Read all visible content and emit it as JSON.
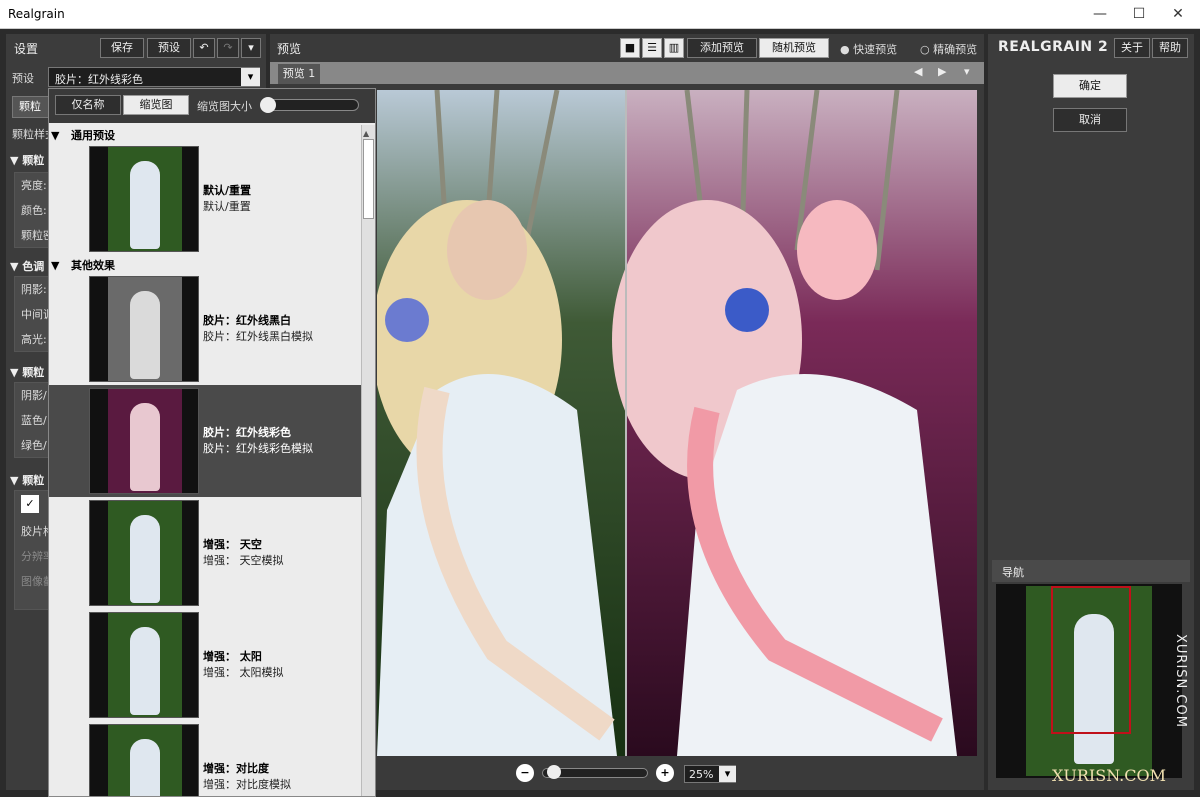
{
  "window": {
    "title": "Realgrain",
    "minimize": "—",
    "maximize": "☐",
    "close": "✕"
  },
  "left": {
    "header": "设置",
    "save": "保存",
    "preset_btn": "预设",
    "preset_label": "预设",
    "preset_value": "胶片：红外线彩色",
    "tab_grain": "颗粒",
    "grain_style_label": "颗粒样式",
    "sections": [
      {
        "title": "颗粒",
        "rows": [
          "亮度:",
          "颜色:",
          "颗粒密"
        ]
      },
      {
        "title": "色调",
        "rows": [
          "阴影:",
          "中间调",
          "高光:"
        ]
      },
      {
        "title": "颗粒",
        "rows": [
          "阴影/",
          "蓝色/",
          "绿色/"
        ]
      },
      {
        "title": "颗粒",
        "rows": [
          "胶片格",
          "分辨率",
          "图像截"
        ]
      }
    ]
  },
  "dropdown": {
    "tab_name_only": "仅名称",
    "tab_thumbs": "缩览图",
    "thumb_size_label": "缩览图大小",
    "groups": [
      {
        "title": "通用预设"
      },
      {
        "title": "其他效果"
      }
    ],
    "items": [
      {
        "name": "默认/重置",
        "desc": "默认/重置",
        "style": "color"
      },
      {
        "name": "胶片：红外线黑白",
        "desc": "胶片：红外线黑白模拟",
        "style": "bw"
      },
      {
        "name": "胶片：红外线彩色",
        "desc": "胶片：红外线彩色模拟",
        "style": "ir"
      },
      {
        "name": "增强：   天空",
        "desc": "增强：   天空模拟",
        "style": "color"
      },
      {
        "name": "增强：   太阳",
        "desc": "增强：   太阳模拟",
        "style": "color"
      },
      {
        "name": "增强：对比度",
        "desc": "增强：对比度模拟",
        "style": "color"
      }
    ]
  },
  "preview": {
    "header": "预览",
    "add_preview": "添加预览",
    "random_preview": "随机预览",
    "fast_preview": "快速预览",
    "accurate_preview": "精确预览",
    "tab": "预览 1",
    "zoom_value": "25%"
  },
  "right": {
    "brand": "REALGRAIN 2",
    "about": "关于",
    "help": "帮助",
    "ok": "确定",
    "cancel": "取消",
    "nav_title": "导航"
  },
  "watermark": {
    "vertical": "XURISN.COM",
    "bottom": "XURISN.COM"
  },
  "colors": {
    "accent_red": "#c0101a",
    "panel": "#3c3c3c",
    "selected_item": "#4a4a4a"
  }
}
